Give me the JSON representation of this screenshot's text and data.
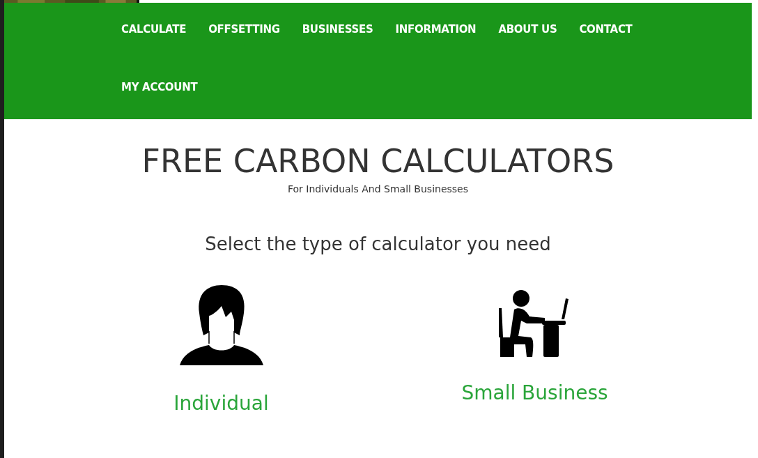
{
  "nav": {
    "items": [
      {
        "label": "CALCULATE"
      },
      {
        "label": "OFFSETTING"
      },
      {
        "label": "BUSINESSES"
      },
      {
        "label": "INFORMATION"
      },
      {
        "label": "ABOUT US"
      },
      {
        "label": "CONTACT"
      },
      {
        "label": "MY ACCOUNT"
      }
    ]
  },
  "hero": {
    "title": "FREE CARBON CALCULATORS",
    "subtitle": "For Individuals And Small Businesses"
  },
  "prompt": "Select the type of calculator you need",
  "options": [
    {
      "kind": "person",
      "label": "Individual"
    },
    {
      "kind": "desk",
      "label": "Small Business"
    }
  ]
}
